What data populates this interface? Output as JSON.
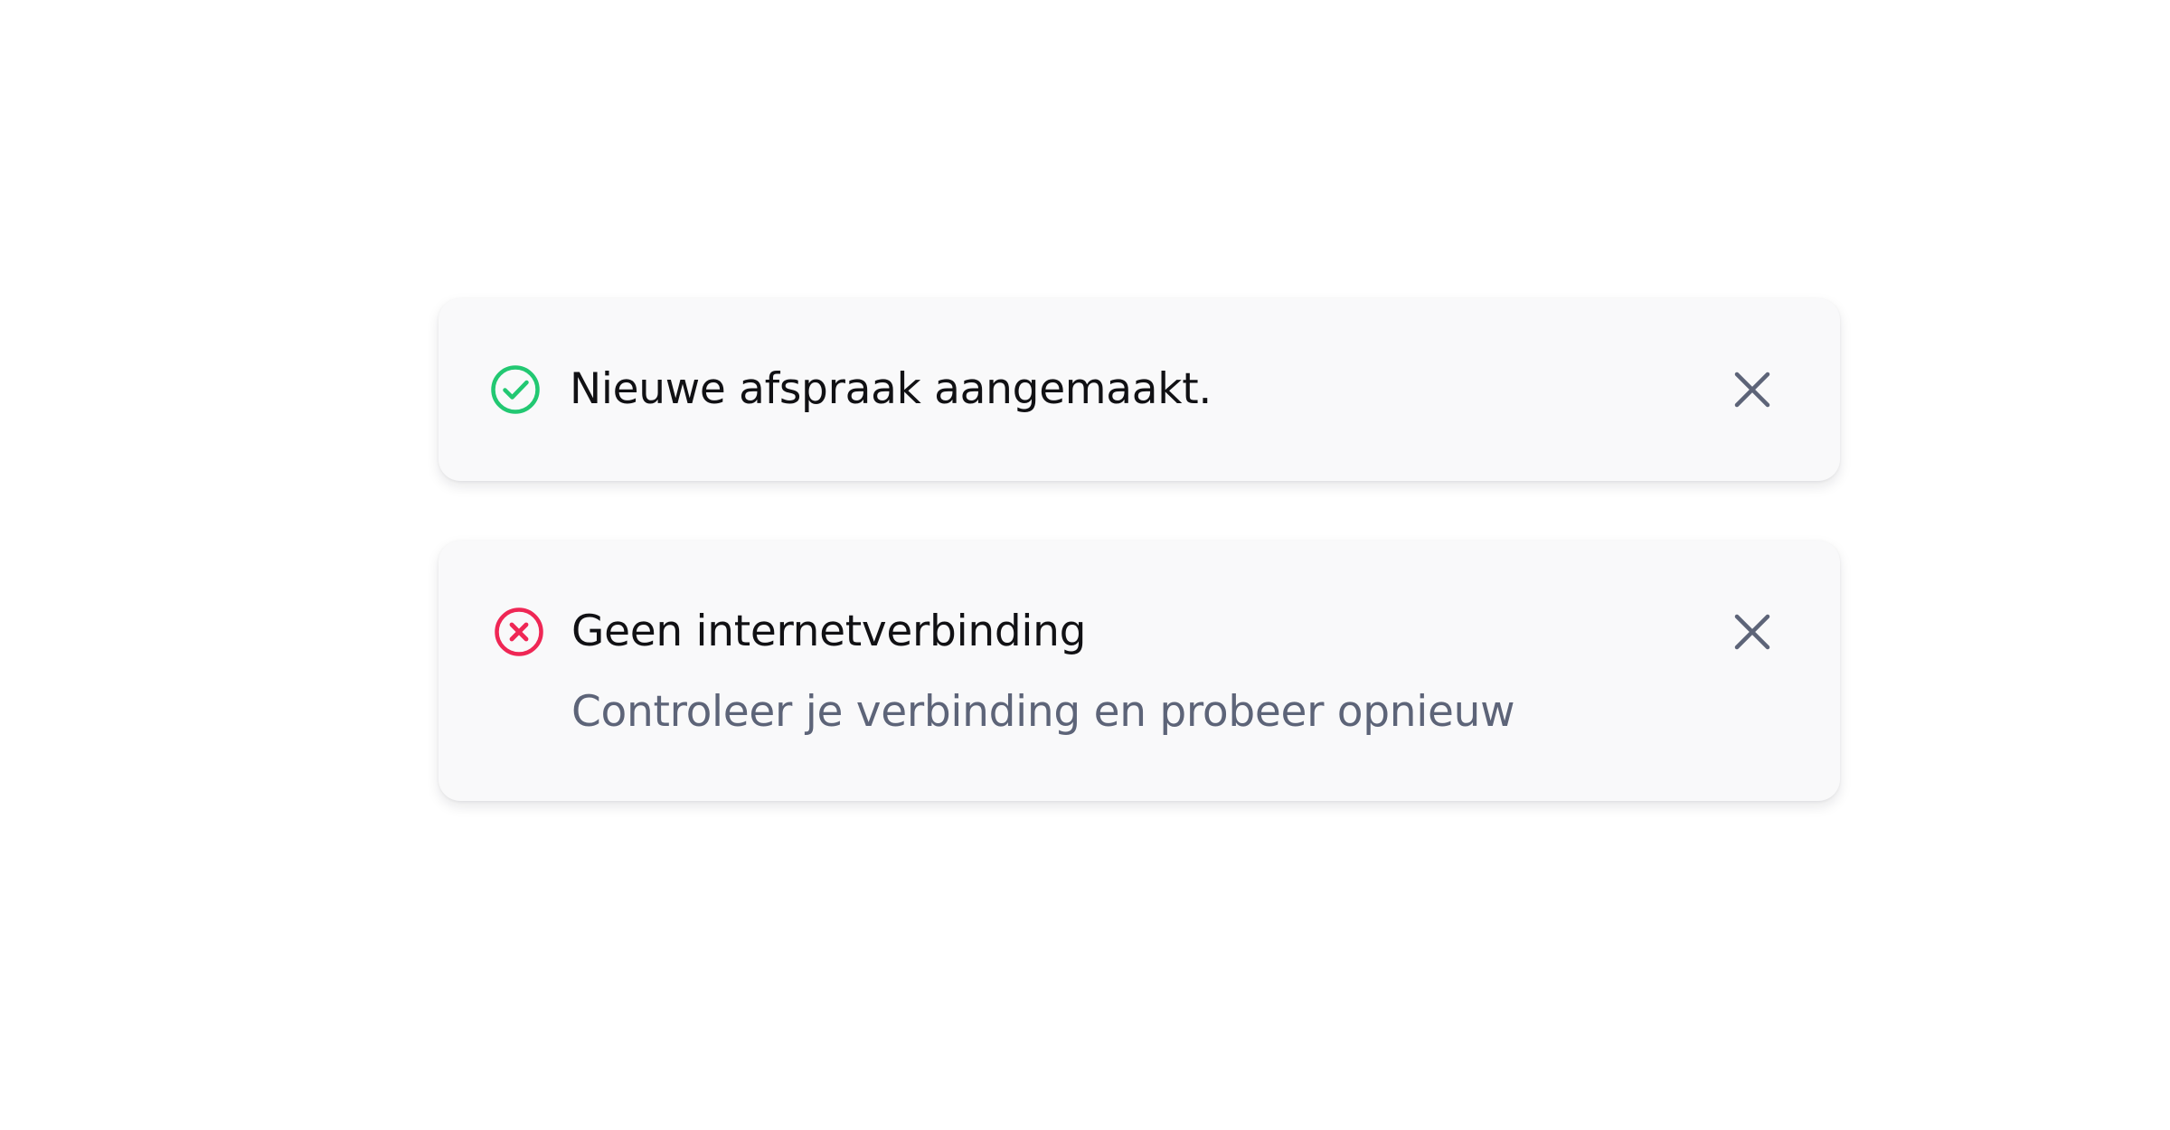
{
  "toasts": [
    {
      "type": "success",
      "icon": "check-circle-icon",
      "title": "Nieuwe afspraak aangemaakt.",
      "close_icon": "close-icon"
    },
    {
      "type": "error",
      "icon": "x-circle-icon",
      "title": "Geen internetverbinding",
      "description": "Controleer je verbinding en probeer opnieuw",
      "close_icon": "close-icon"
    }
  ],
  "colors": {
    "success": "#22c872",
    "error": "#ef2755",
    "title_text": "#111114",
    "description_text": "#5d6478",
    "close_icon": "#5d6478",
    "toast_background": "#f9f9fa",
    "page_background": "#ffffff"
  }
}
